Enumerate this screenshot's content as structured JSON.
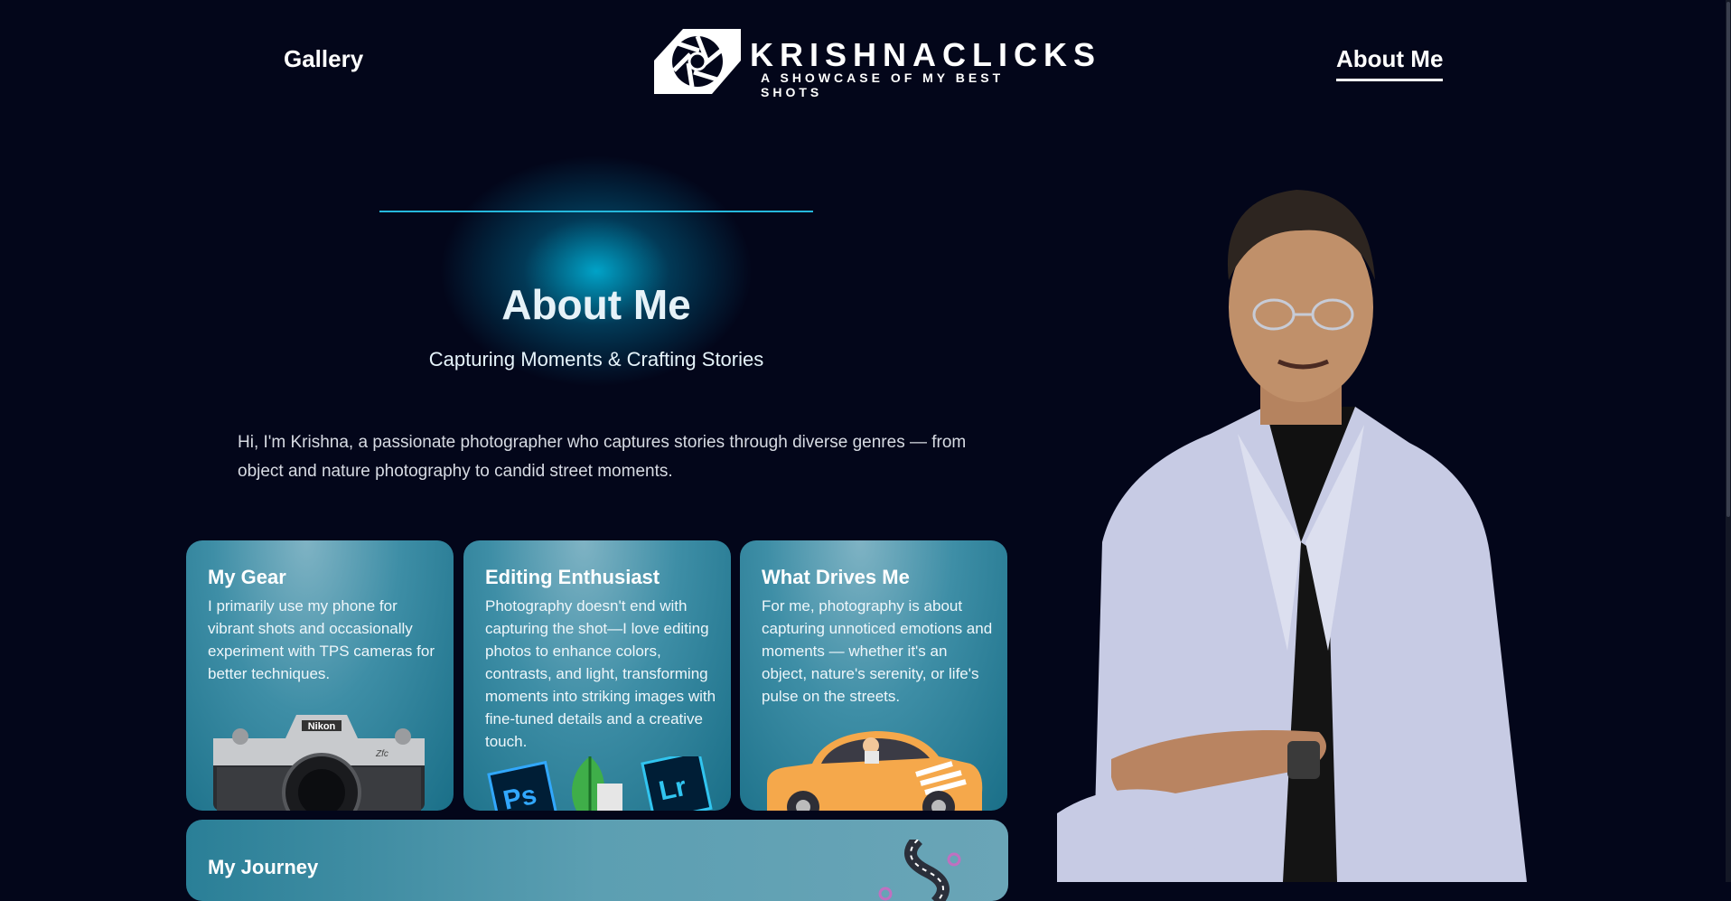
{
  "nav": {
    "gallery_label": "Gallery",
    "about_label": "About Me"
  },
  "logo": {
    "title": "KRISHNACLICKS",
    "tagline": "A SHOWCASE OF MY BEST SHOTS"
  },
  "hero": {
    "title": "About Me",
    "subtitle": "Capturing Moments & Crafting Stories"
  },
  "intro": "Hi, I'm Krishna, a passionate photographer who captures stories through diverse genres — from object and nature photography to candid street moments.",
  "cards": [
    {
      "title": "My Gear",
      "text": "I primarily use my phone for vibrant shots and occasionally experiment with TPS cameras for better techniques.",
      "icon": "camera-icon",
      "camera_brand": "Nikon",
      "camera_model": "Zfc"
    },
    {
      "title": "Editing Enthusiast",
      "text": "Photography doesn't end with capturing the shot—I love editing photos to enhance colors, contrasts, and light, transforming moments into striking images with fine-tuned details and a creative touch.",
      "icons": [
        "photoshop-icon",
        "snapseed-icon",
        "lightroom-icon"
      ],
      "ps_label": "Ps",
      "lr_label": "Lr"
    },
    {
      "title": "What Drives Me",
      "text": "For me, photography is about capturing unnoticed emotions and moments — whether it's an object, nature's serenity, or life's pulse on the streets.",
      "icon": "car-icon"
    }
  ],
  "journey": {
    "title": "My Journey",
    "icon": "road-map-icon"
  },
  "colors": {
    "background": "#03061a",
    "accent": "#25b8dc",
    "card": "#3e8ea6"
  }
}
